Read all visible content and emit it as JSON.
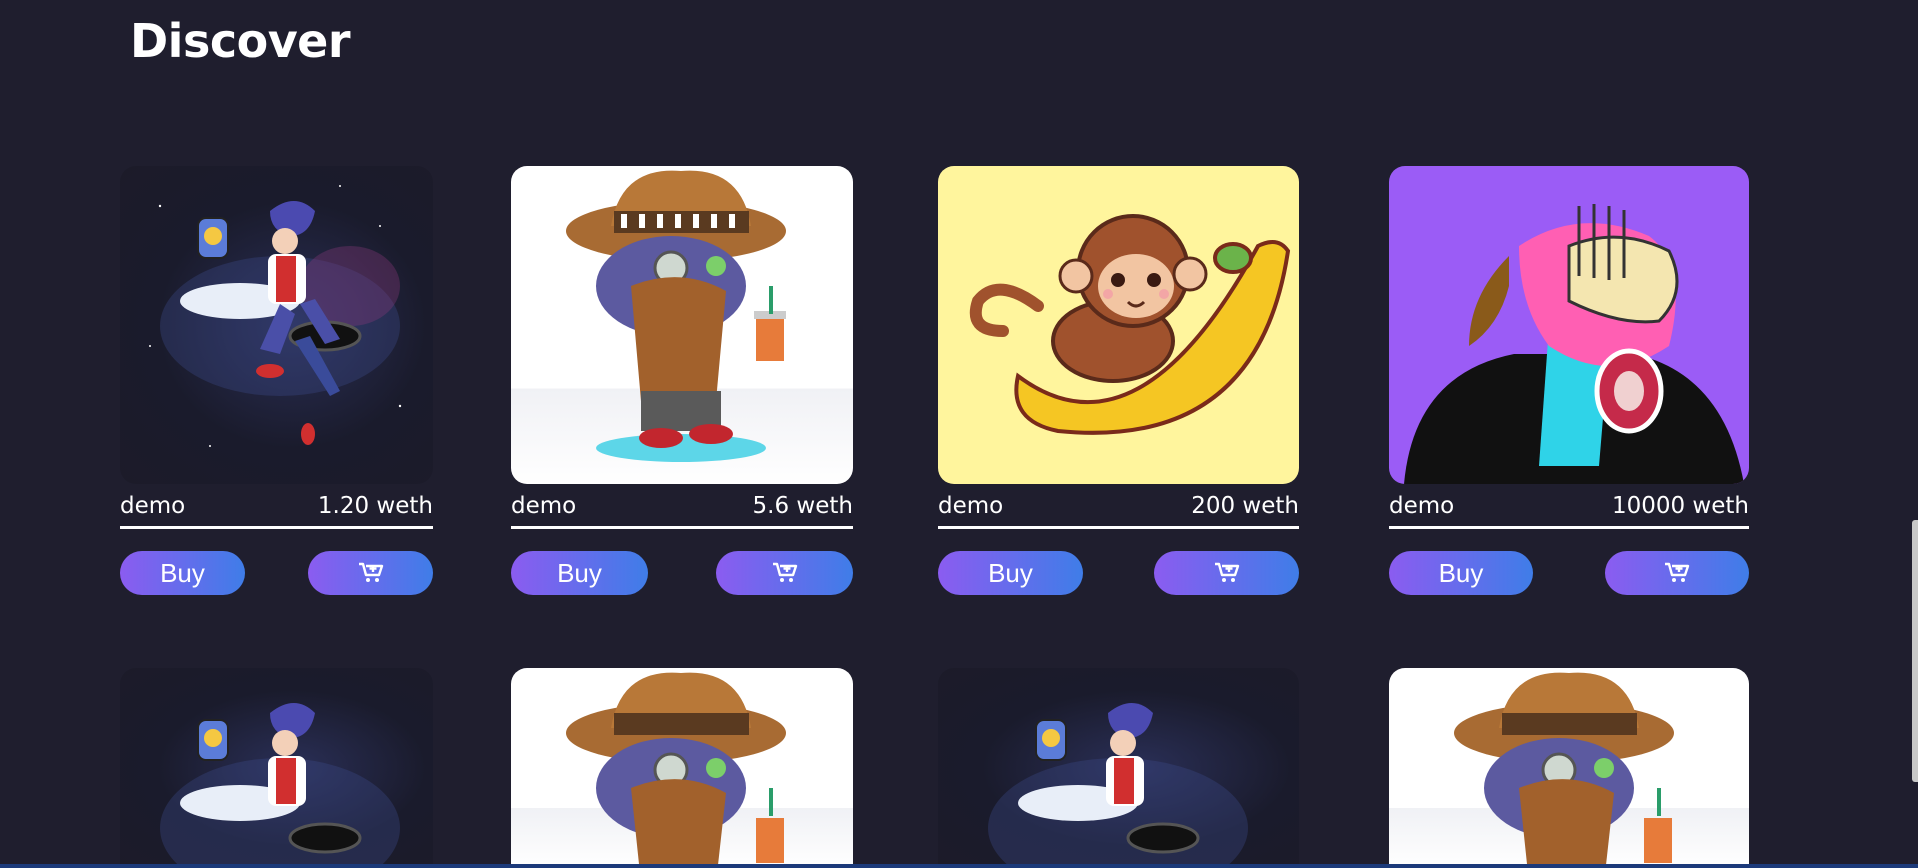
{
  "page": {
    "title": "Discover"
  },
  "items_row1": [
    {
      "name": "demo",
      "price": "1.20 weth",
      "art": "astronaut-girl-art",
      "buy_label": "Buy",
      "cart_icon": "add-to-cart-icon"
    },
    {
      "name": "demo",
      "price": "5.6 weth",
      "art": "cowboy-cat-art",
      "buy_label": "Buy",
      "cart_icon": "add-to-cart-icon"
    },
    {
      "name": "demo",
      "price": "200 weth",
      "art": "monkey-banana-art",
      "buy_label": "Buy",
      "cart_icon": "add-to-cart-icon"
    },
    {
      "name": "demo",
      "price": "10000 weth",
      "art": "dino-punk-art",
      "buy_label": "Buy",
      "cart_icon": "add-to-cart-icon"
    }
  ],
  "items_row2": [
    {
      "art": "astronaut-girl-art"
    },
    {
      "art": "cowboy-cat-art"
    },
    {
      "art": "astronaut-girl-art"
    },
    {
      "art": "cowboy-cat-art"
    }
  ],
  "colors": {
    "background": "#1f1e2e",
    "button_gradient_start": "#8b5cf0",
    "button_gradient_end": "#3f7de8",
    "yellow_card": "#fff59d",
    "purple_card": "#9b5cf6"
  }
}
